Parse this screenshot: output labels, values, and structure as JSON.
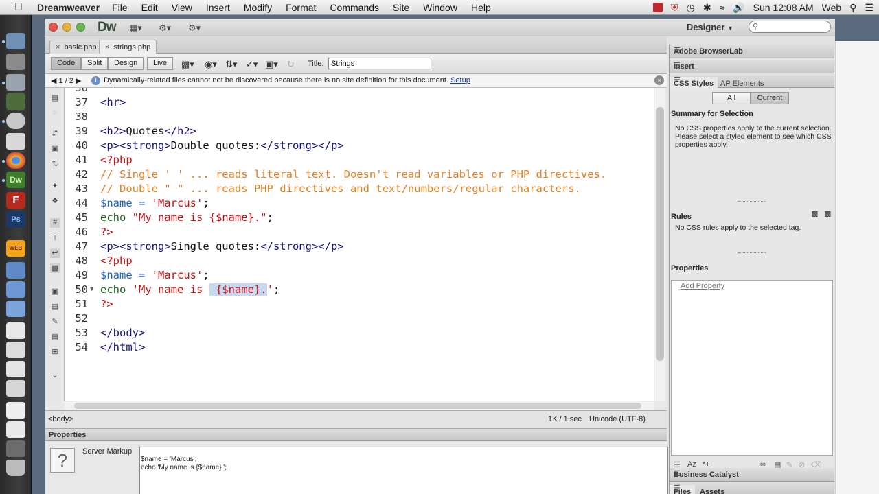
{
  "menubar": {
    "app_name": "Dreamweaver",
    "items": [
      "File",
      "Edit",
      "View",
      "Insert",
      "Modify",
      "Format",
      "Commands",
      "Site",
      "Window",
      "Help"
    ],
    "clock": "Sun 12:08 AM",
    "user": "Web"
  },
  "window": {
    "logo": "Dw",
    "workspace": "Designer"
  },
  "tabs": [
    {
      "label": "basic.php",
      "active": false
    },
    {
      "label": "strings.php",
      "active": true
    }
  ],
  "toolbar": {
    "views": [
      "Code",
      "Split",
      "Design",
      "Live"
    ],
    "active_view": "Code",
    "title_label": "Title:",
    "title_value": "Strings"
  },
  "infobar": {
    "nav": "1 / 2",
    "message": "Dynamically-related files cannot not be discovered because there is no site definition for this document.",
    "link": "Setup"
  },
  "code_lines": [
    {
      "n": "36",
      "segs": []
    },
    {
      "n": "37",
      "segs": [
        [
          "tag",
          "<hr>"
        ]
      ]
    },
    {
      "n": "38",
      "segs": []
    },
    {
      "n": "39",
      "segs": [
        [
          "tag",
          "<h2>"
        ],
        [
          "txt",
          "Quotes"
        ],
        [
          "tag",
          "</h2>"
        ]
      ]
    },
    {
      "n": "40",
      "segs": [
        [
          "tag",
          "<p><strong>"
        ],
        [
          "txt",
          "Double quotes:"
        ],
        [
          "tag",
          "</strong></p>"
        ]
      ]
    },
    {
      "n": "41",
      "segs": [
        [
          "php",
          "<?php"
        ]
      ]
    },
    {
      "n": "42",
      "segs": [
        [
          "com",
          "// Single ' ' ... reads literal text. Doesn't read variables or PHP directives."
        ]
      ]
    },
    {
      "n": "43",
      "segs": [
        [
          "com",
          "// Double \" \" ... reads PHP directives and text/numbers/regular characters."
        ]
      ]
    },
    {
      "n": "44",
      "segs": [
        [
          "var",
          "$name"
        ],
        [
          "op",
          " = "
        ],
        [
          "str",
          "'Marcus'"
        ],
        [
          "txt",
          ";"
        ]
      ]
    },
    {
      "n": "45",
      "segs": [
        [
          "kw",
          "echo "
        ],
        [
          "str",
          "\"My name is {$name}.\""
        ],
        [
          "txt",
          ";"
        ]
      ]
    },
    {
      "n": "46",
      "segs": [
        [
          "php",
          "?>"
        ]
      ]
    },
    {
      "n": "47",
      "segs": [
        [
          "tag",
          "<p><strong>"
        ],
        [
          "txt",
          "Single quotes:"
        ],
        [
          "tag",
          "</strong></p>"
        ]
      ]
    },
    {
      "n": "48",
      "segs": [
        [
          "php",
          "<?php"
        ]
      ]
    },
    {
      "n": "49",
      "segs": [
        [
          "var",
          "$name"
        ],
        [
          "op",
          " = "
        ],
        [
          "str",
          "'Marcus'"
        ],
        [
          "txt",
          ";"
        ]
      ]
    },
    {
      "n": "50",
      "fold": true,
      "segs": [
        [
          "kw",
          "echo "
        ],
        [
          "str",
          "'My name is "
        ],
        [
          "sel",
          " {$name}."
        ],
        [
          "str",
          "'"
        ],
        [
          "txt",
          ";"
        ]
      ]
    },
    {
      "n": "51",
      "segs": [
        [
          "php",
          "?>"
        ]
      ]
    },
    {
      "n": "52",
      "segs": []
    },
    {
      "n": "53",
      "segs": [
        [
          "tag",
          "</body>"
        ]
      ]
    },
    {
      "n": "54",
      "segs": [
        [
          "tag",
          "</html>"
        ]
      ]
    }
  ],
  "status": {
    "tag": "<body>",
    "size": "1K / 1 sec",
    "encoding": "Unicode (UTF-8)"
  },
  "properties": {
    "header": "Properties",
    "label": "Server Markup",
    "markup": "$name = 'Marcus';\necho 'My name is {$name}.';"
  },
  "right_panels": {
    "browserlab": "Adobe BrowserLab",
    "insert": "Insert",
    "css_tab": "CSS Styles",
    "ap_tab": "AP Elements",
    "all": "All",
    "current": "Current",
    "summary_title": "Summary for Selection",
    "summary_text": "No CSS properties apply to the current selection.  Please select a styled element to see which CSS properties apply.",
    "rules_title": "Rules",
    "rules_text": "No CSS rules apply to the selected tag.",
    "props_title": "Properties",
    "add_property": "Add Property",
    "business": "Business Catalyst",
    "files_tab": "Files",
    "assets_tab": "Assets"
  }
}
